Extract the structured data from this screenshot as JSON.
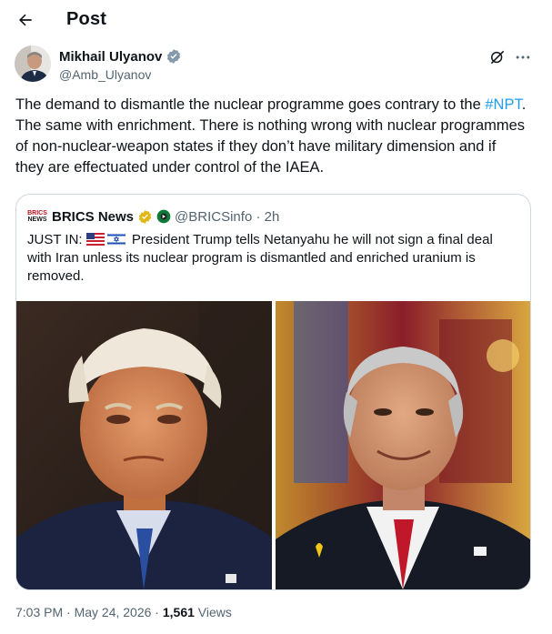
{
  "header": {
    "back_label": "←",
    "title": "Post"
  },
  "author": {
    "name": "Mikhail Ulyanov",
    "handle": "@Amb_Ulyanov"
  },
  "post": {
    "text_before": "The demand to dismantle the nuclear programme goes contrary  to the ",
    "hashtag": "#NPT",
    "text_after": ". The same with enrichment. There is nothing wrong  with nuclear programmes of non-nuclear-weapon states if they don’t have military dimension and if they are effectuated under control of the IAEA."
  },
  "quote": {
    "logo_text_top": "BRICS",
    "logo_text_bottom": "NEWS",
    "name": "BRICS News",
    "handle_time": "@BRICSinfo · 2h",
    "text_prefix": "JUST IN: ",
    "text_body": " President Trump tells Netanyahu he will not sign a final deal with Iran unless its nuclear program is dismantled and enriched uranium is removed."
  },
  "meta": {
    "timestamp": "7:03 PM · May 24, 2026 · ",
    "views_count": "1,561",
    "views_label": " Views"
  },
  "colors": {
    "accent": "#1d9bf0",
    "verified_gold": "#e2b719",
    "text": "#0f1419",
    "muted": "#536471",
    "border": "#cfd9de"
  }
}
